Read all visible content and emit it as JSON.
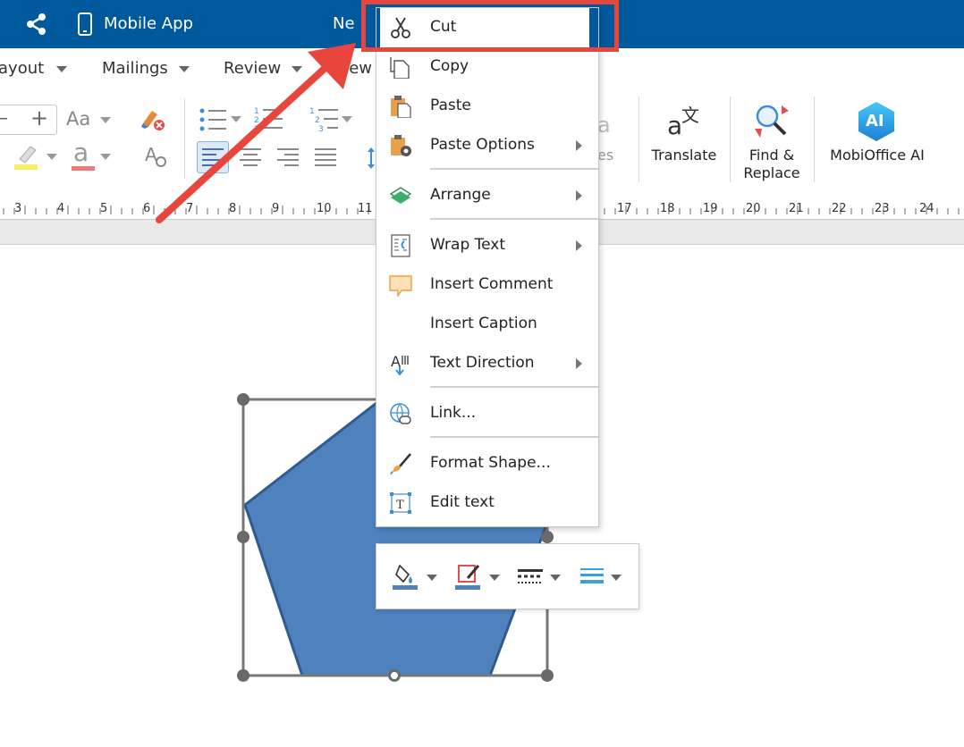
{
  "titlebar": {
    "app_name": "Mobile App",
    "doc_title_fragment": "Ne"
  },
  "ribbon": {
    "tabs": [
      {
        "label": "Layout"
      },
      {
        "label": "Mailings"
      },
      {
        "label": "Review"
      },
      {
        "label": "View"
      }
    ],
    "font_size_decrease": "–",
    "font_size_increase": "+",
    "change_case": "Aa",
    "styles_fragment": "es",
    "translate_label": "Translate",
    "find_replace_label_1": "Find &",
    "find_replace_label_2": "Replace",
    "ai_label": "MobiOffice AI",
    "ai_badge": "AI",
    "translate_glyph": "a文"
  },
  "ruler": {
    "numbers": [
      "3",
      "4",
      "5",
      "6",
      "7",
      "8",
      "9",
      "10",
      "11",
      "17",
      "18",
      "19",
      "20",
      "21",
      "22",
      "23",
      "24"
    ]
  },
  "context_menu": {
    "items": [
      {
        "label": "Cut",
        "icon": "scissors-icon",
        "submenu": false
      },
      {
        "label": "Copy",
        "icon": "copy-icon",
        "submenu": false
      },
      {
        "label": "Paste",
        "icon": "clipboard-icon",
        "submenu": false
      },
      {
        "label": "Paste Options",
        "icon": "paste-options-icon",
        "submenu": true
      },
      {
        "label": "Arrange",
        "icon": "layers-icon",
        "submenu": true
      },
      {
        "label": "Wrap Text",
        "icon": "wrap-text-icon",
        "submenu": true
      },
      {
        "label": "Insert Comment",
        "icon": "comment-icon",
        "submenu": false
      },
      {
        "label": "Insert Caption",
        "icon": "",
        "submenu": false
      },
      {
        "label": "Text Direction",
        "icon": "text-direction-icon",
        "submenu": true
      },
      {
        "label": "Link...",
        "icon": "link-icon",
        "submenu": false
      },
      {
        "label": "Format Shape...",
        "icon": "paintbrush-icon",
        "submenu": false
      },
      {
        "label": "Edit text",
        "icon": "edit-text-icon",
        "submenu": false
      }
    ]
  },
  "colors": {
    "titlebar": "#00599c",
    "highlight_box": "#e8453c",
    "shape_fill": "#4f81bd",
    "shape_stroke": "#2f5b8e",
    "menu_selected_bar": "#00599c"
  }
}
